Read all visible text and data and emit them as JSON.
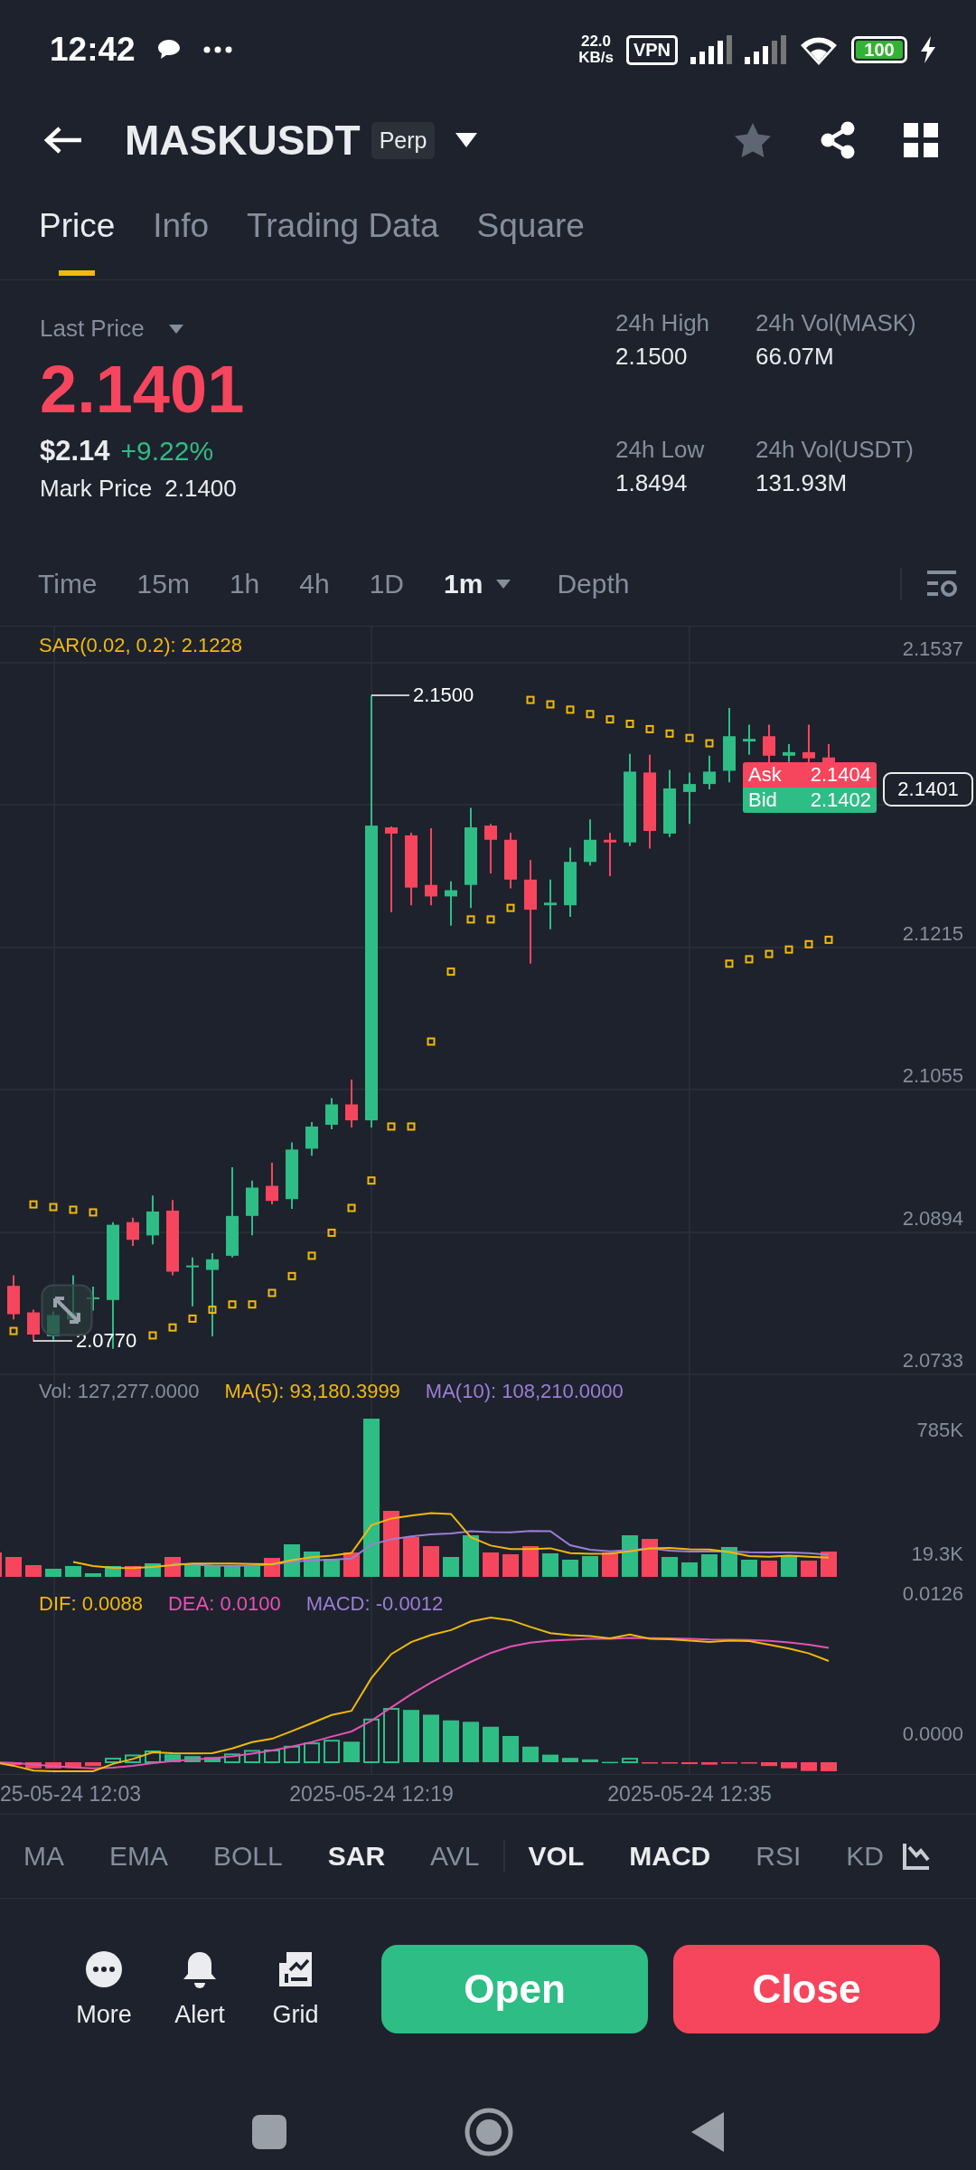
{
  "status_bar": {
    "time": "12:42",
    "net_speed": "22.0",
    "net_unit": "KB/s",
    "vpn": "VPN",
    "battery": "100"
  },
  "header": {
    "symbol": "MASKUSDT",
    "badge": "Perp",
    "favorite": false
  },
  "tabs": [
    {
      "label": "Price",
      "selected": true
    },
    {
      "label": "Info",
      "selected": false
    },
    {
      "label": "Trading Data",
      "selected": false
    },
    {
      "label": "Square",
      "selected": false
    }
  ],
  "ticker": {
    "last_price_label": "Last Price",
    "last_price": "2.1401",
    "usd_price": "$2.14",
    "change": "+9.22%",
    "mark_price_label": "Mark Price",
    "mark_price": "2.1400",
    "stats": [
      {
        "label": "24h High",
        "value": "2.1500"
      },
      {
        "label": "24h Vol(MASK)",
        "value": "66.07M"
      },
      {
        "label": "24h Low",
        "value": "1.8494"
      },
      {
        "label": "24h Vol(USDT)",
        "value": "131.93M"
      }
    ]
  },
  "intervals": [
    {
      "label": "Time",
      "selected": false,
      "dropdown": false
    },
    {
      "label": "15m",
      "selected": false,
      "dropdown": false
    },
    {
      "label": "1h",
      "selected": false,
      "dropdown": false
    },
    {
      "label": "4h",
      "selected": false,
      "dropdown": false
    },
    {
      "label": "1D",
      "selected": false,
      "dropdown": false
    },
    {
      "label": "1m",
      "selected": true,
      "dropdown": true
    },
    {
      "label": "Depth",
      "selected": false,
      "dropdown": false
    }
  ],
  "chart": {
    "indicator_label": "SAR(0.02, 0.2): 2.1228",
    "price_axis": [
      "2.1537",
      "2.1215",
      "2.1055",
      "2.0894",
      "2.0733"
    ],
    "high_marker": "2.1500",
    "low_marker": "2.0770",
    "ask": {
      "label": "Ask",
      "value": "2.1404"
    },
    "bid": {
      "label": "Bid",
      "value": "2.1402"
    },
    "last_price_tag": "2.1401"
  },
  "volume": {
    "legend": [
      {
        "text": "Vol: 127,277.0000",
        "color": "#848e9c"
      },
      {
        "text": "MA(5): 93,180.3999",
        "color": "#f0b90b"
      },
      {
        "text": "MA(10): 108,210.0000",
        "color": "#9b7fd4"
      }
    ],
    "axis": [
      "785K",
      "19.3K"
    ]
  },
  "macd": {
    "legend": [
      {
        "text": "DIF: 0.0088",
        "color": "#f0b90b"
      },
      {
        "text": "DEA: 0.0100",
        "color": "#e452b4"
      },
      {
        "text": "MACD: -0.0012",
        "color": "#9b7fd4"
      }
    ],
    "axis": [
      "0.0126",
      "0.0000"
    ]
  },
  "time_axis": [
    "25-05-24 12:03",
    "2025-05-24 12:19",
    "2025-05-24 12:35"
  ],
  "main_indicators": [
    {
      "label": "MA",
      "selected": false
    },
    {
      "label": "EMA",
      "selected": false
    },
    {
      "label": "BOLL",
      "selected": false
    },
    {
      "label": "SAR",
      "selected": true
    },
    {
      "label": "AVL",
      "selected": false
    }
  ],
  "sub_indicators": [
    {
      "label": "VOL",
      "selected": true
    },
    {
      "label": "MACD",
      "selected": true
    },
    {
      "label": "RSI",
      "selected": false
    },
    {
      "label": "KD",
      "selected": false
    }
  ],
  "actions": [
    {
      "label": "More",
      "kind": "more"
    },
    {
      "label": "Alert",
      "kind": "alert"
    },
    {
      "label": "Grid",
      "kind": "grid"
    }
  ],
  "buttons": [
    {
      "label": "Open",
      "kind": "buy"
    },
    {
      "label": "Close",
      "kind": "sell"
    }
  ]
}
